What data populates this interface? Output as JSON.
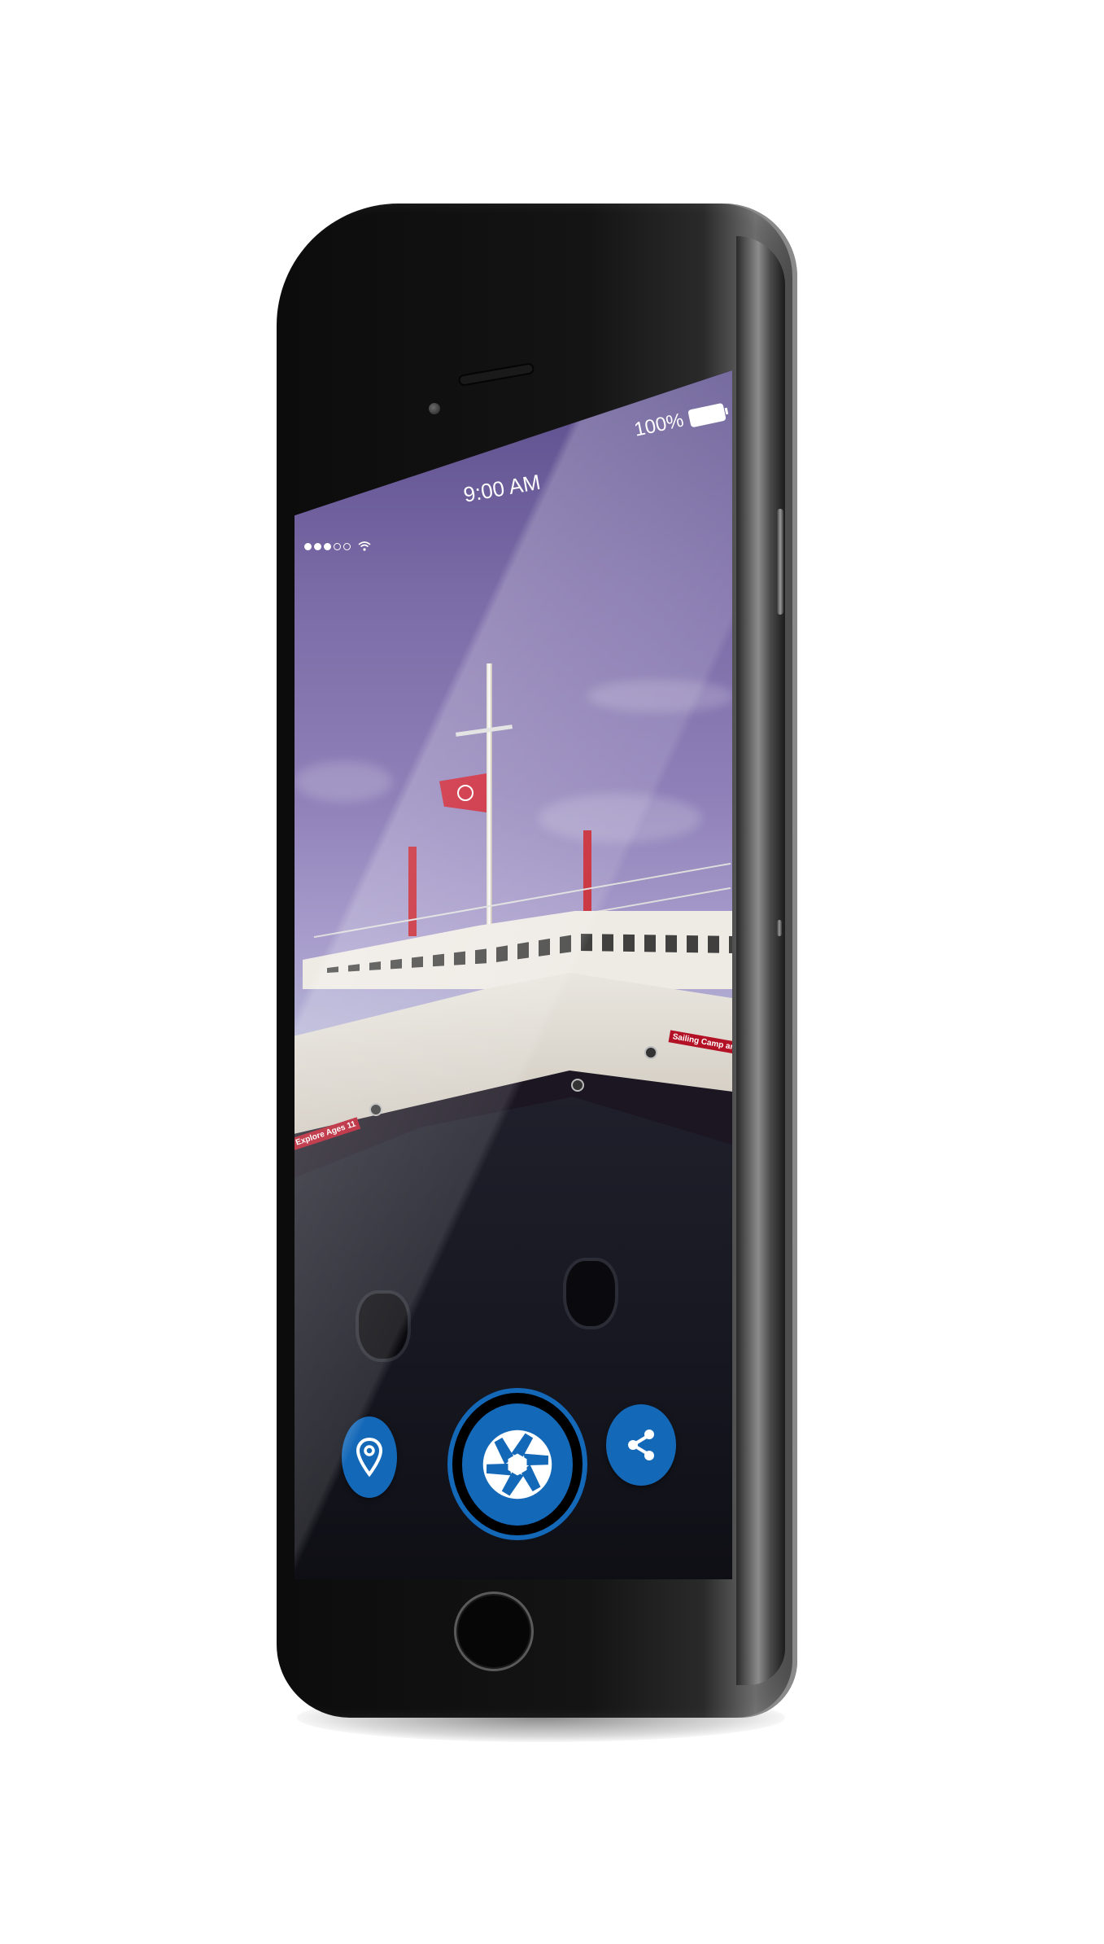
{
  "status_bar": {
    "signal_filled": 3,
    "signal_total": 5,
    "time": "9:00 AM",
    "battery_percent": "100%"
  },
  "photo": {
    "banner_right": "Sailing Camp and Lea",
    "banner_left": "Explore Ages 11"
  },
  "actions": {
    "location_icon": "location-pin-icon",
    "shutter_icon": "camera-shutter-icon",
    "share_icon": "share-icon"
  },
  "colors": {
    "accent": "#1468b8",
    "sky_top": "#5b4e8c",
    "flag": "#c8182b"
  }
}
